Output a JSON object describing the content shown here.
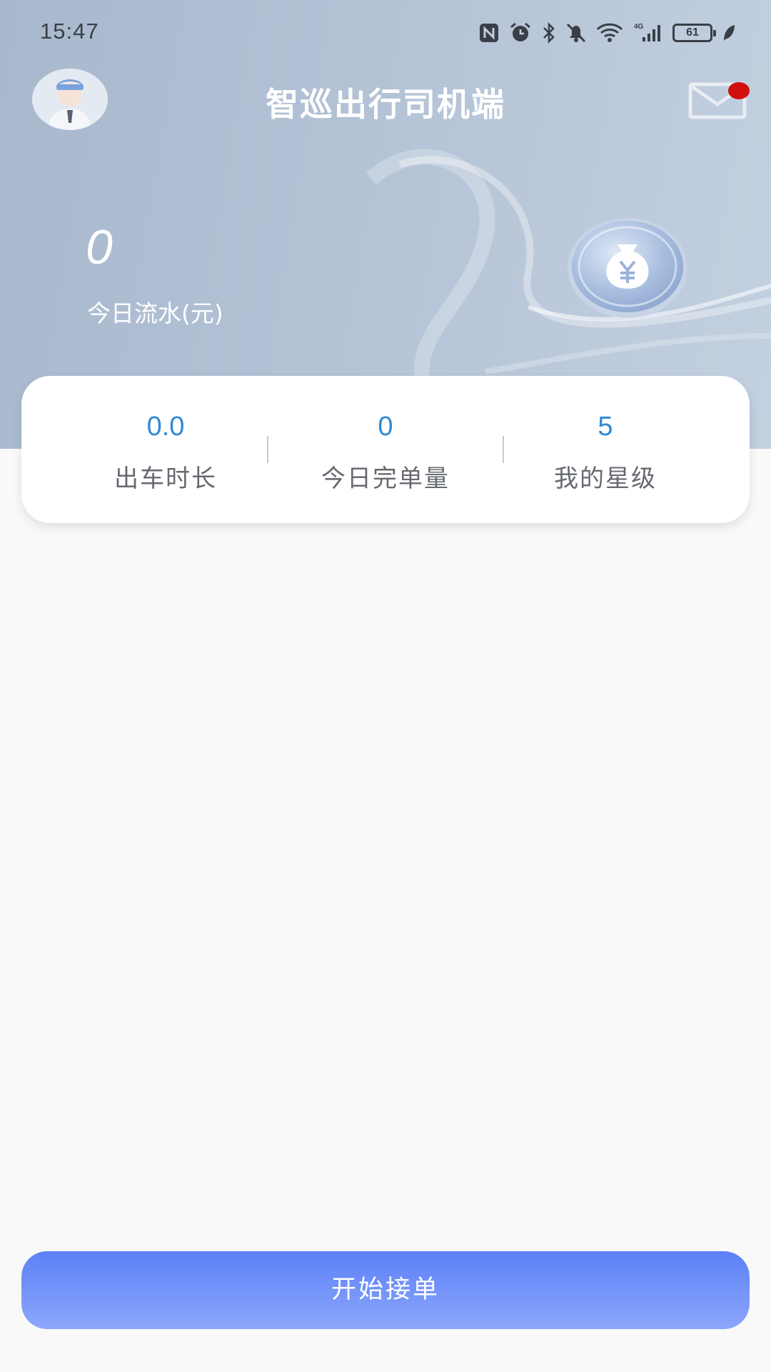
{
  "status_bar": {
    "time": "15:47",
    "network": "4G",
    "battery": "61",
    "icons": [
      "nfc-icon",
      "alarm-icon",
      "bluetooth-icon",
      "bell-off-icon",
      "wifi-icon",
      "signal-icon",
      "battery-icon",
      "leaf-icon"
    ]
  },
  "header": {
    "title": "智巡出行司机端",
    "avatar_icon": "driver-avatar-icon",
    "mail_icon": "mail-icon",
    "has_unread": true
  },
  "earnings": {
    "value": "0",
    "label": "今日流水(元)",
    "icon": "money-bag-icon"
  },
  "stats": [
    {
      "value": "0.0",
      "label": "出车时长"
    },
    {
      "value": "0",
      "label": "今日完单量"
    },
    {
      "value": "5",
      "label": "我的星级"
    }
  ],
  "actions": {
    "start_label": "开始接单"
  },
  "colors": {
    "header_bg": "#b0bfd3",
    "stat_value": "#2f89d4",
    "button_top": "#5c80f7",
    "button_bottom": "#8ca7fb",
    "badge": "#d10f0f"
  }
}
